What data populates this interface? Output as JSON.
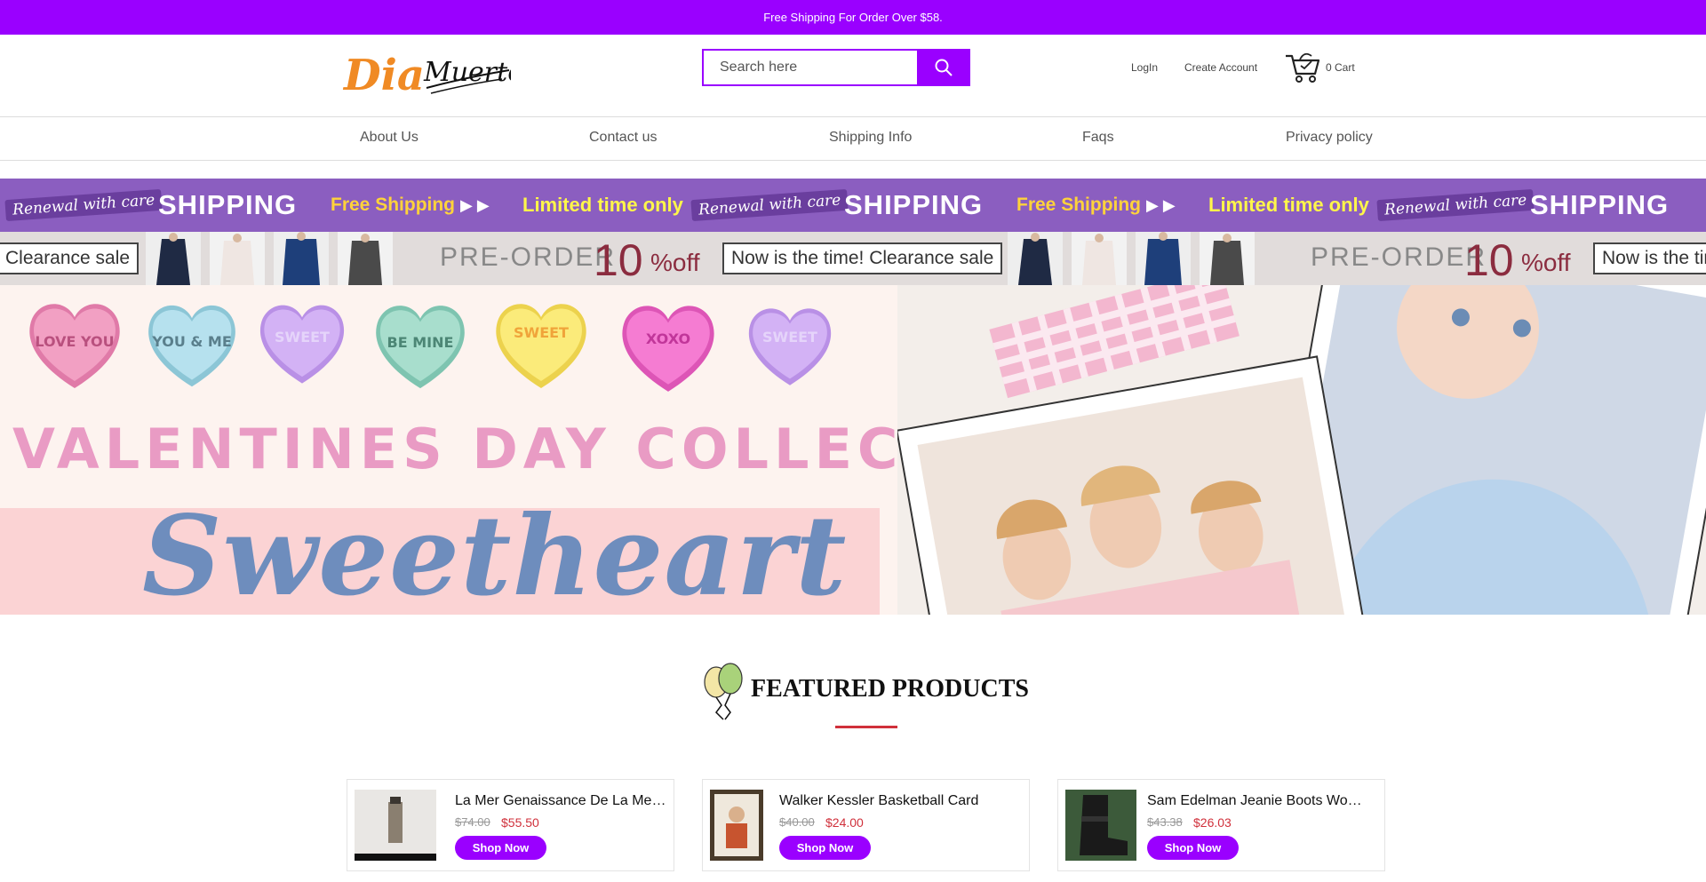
{
  "colors": {
    "accent": "#9a00ff",
    "sale": "#d0303b",
    "banner_purple": "#8b5ec0"
  },
  "topbar": {
    "text": "Free Shipping For Order Over $58."
  },
  "header": {
    "logo": {
      "word1": "Dia",
      "word2": "Muertos"
    },
    "search": {
      "placeholder": "Search here",
      "icon": "search-icon"
    },
    "login": "LogIn",
    "create_account": "Create Account",
    "cart": {
      "label": "0 Cart",
      "icon": "cart-icon"
    }
  },
  "nav": {
    "items": [
      "About Us",
      "Contact us",
      "Shipping Info",
      "Faqs",
      "Privacy policy"
    ]
  },
  "marquee1": {
    "renew": "Renewal with care",
    "shipping": "SHIPPING",
    "free": "Free Shipping",
    "limited": "Limited time only"
  },
  "marquee2": {
    "clearance": "Clearance sale",
    "preorder": "PRE-ORDER",
    "ten": "10",
    "off": "%off",
    "now": "Now is the time! Clearance sale"
  },
  "hero": {
    "hearts": [
      "LOVE YOU",
      "YOU & ME",
      "SWEET",
      "BE MINE",
      "SWEET",
      "XOXO",
      "SWEET"
    ],
    "title": "VALENTINES DAY COLLECTION",
    "big": "Sweetheart"
  },
  "featured": {
    "title": "FEATURED PRODUCTS",
    "products": [
      {
        "name": "La Mer Genaissance De La Mer The Serum",
        "old_price": "$74.00",
        "new_price": "$55.50",
        "button": "Shop Now"
      },
      {
        "name": "Walker Kessler Basketball Card",
        "old_price": "$40.00",
        "new_price": "$24.00",
        "button": "Shop Now"
      },
      {
        "name": "Sam Edelman Jeanie Boots Women",
        "old_price": "$43.38",
        "new_price": "$26.03",
        "button": "Shop Now"
      }
    ]
  }
}
